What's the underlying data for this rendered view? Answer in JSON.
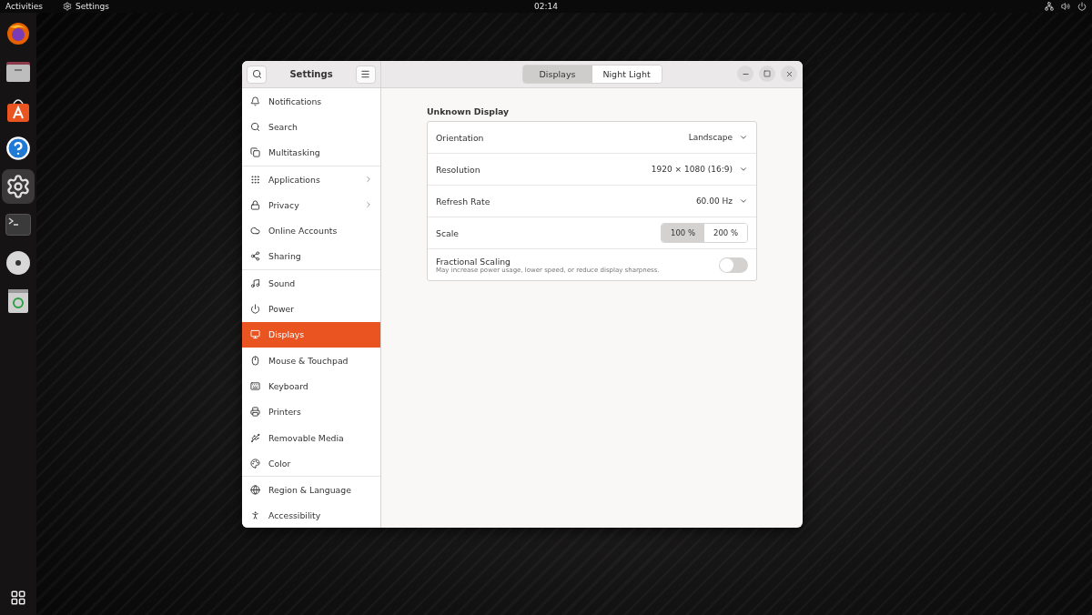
{
  "top_bar": {
    "activities": "Activities",
    "app_name": "Settings",
    "clock": "02:14"
  },
  "dock": {
    "items": [
      {
        "kind": "browser",
        "selected": false
      },
      {
        "kind": "files",
        "selected": false
      },
      {
        "kind": "store",
        "selected": false
      },
      {
        "kind": "help",
        "selected": false
      },
      {
        "kind": "settings",
        "selected": true
      },
      {
        "kind": "terminal",
        "selected": false
      },
      {
        "kind": "disc",
        "selected": false
      },
      {
        "kind": "trash",
        "selected": false
      }
    ]
  },
  "window": {
    "title": "Settings",
    "sidebar": {
      "groups": [
        {
          "items": [
            {
              "label": "Notifications",
              "kind": "bell",
              "selected": false,
              "arrow": false
            },
            {
              "label": "Search",
              "kind": "search",
              "selected": false,
              "arrow": false
            },
            {
              "label": "Multitasking",
              "kind": "windows",
              "selected": false,
              "arrow": false
            }
          ]
        },
        {
          "items": [
            {
              "label": "Applications",
              "kind": "grid",
              "selected": false,
              "arrow": true
            },
            {
              "label": "Privacy",
              "kind": "lock",
              "selected": false,
              "arrow": true
            },
            {
              "label": "Online Accounts",
              "kind": "cloud",
              "selected": false,
              "arrow": false
            },
            {
              "label": "Sharing",
              "kind": "share",
              "selected": false,
              "arrow": false
            }
          ]
        },
        {
          "items": [
            {
              "label": "Sound",
              "kind": "music",
              "selected": false,
              "arrow": false
            },
            {
              "label": "Power",
              "kind": "power",
              "selected": false,
              "arrow": false
            },
            {
              "label": "Displays",
              "kind": "monitor",
              "selected": true,
              "arrow": false
            },
            {
              "label": "Mouse & Touchpad",
              "kind": "mouse",
              "selected": false,
              "arrow": false
            },
            {
              "label": "Keyboard",
              "kind": "keyboard",
              "selected": false,
              "arrow": false
            },
            {
              "label": "Printers",
              "kind": "printer",
              "selected": false,
              "arrow": false
            },
            {
              "label": "Removable Media",
              "kind": "usb",
              "selected": false,
              "arrow": false
            },
            {
              "label": "Color",
              "kind": "palette",
              "selected": false,
              "arrow": false
            }
          ]
        },
        {
          "items": [
            {
              "label": "Region & Language",
              "kind": "globe",
              "selected": false,
              "arrow": false
            },
            {
              "label": "Accessibility",
              "kind": "person",
              "selected": false,
              "arrow": false
            }
          ]
        }
      ]
    },
    "tabs": [
      {
        "label": "Displays",
        "selected": true
      },
      {
        "label": "Night Light",
        "selected": false
      }
    ],
    "section_title": "Unknown Display",
    "rows": [
      {
        "kind": "dropdown",
        "label": "Orientation",
        "value": "Landscape"
      },
      {
        "kind": "dropdown",
        "label": "Resolution",
        "value": "1920 × 1080 (16:9)"
      },
      {
        "kind": "dropdown",
        "label": "Refresh Rate",
        "value": "60.00 Hz"
      },
      {
        "kind": "scale",
        "label": "Scale",
        "options": [
          {
            "label": "100 %",
            "selected": true
          },
          {
            "label": "200 %",
            "selected": false
          }
        ]
      },
      {
        "kind": "switch",
        "label": "Fractional Scaling",
        "description": "May increase power usage, lower speed, or reduce display sharpness.",
        "on": false
      }
    ]
  }
}
